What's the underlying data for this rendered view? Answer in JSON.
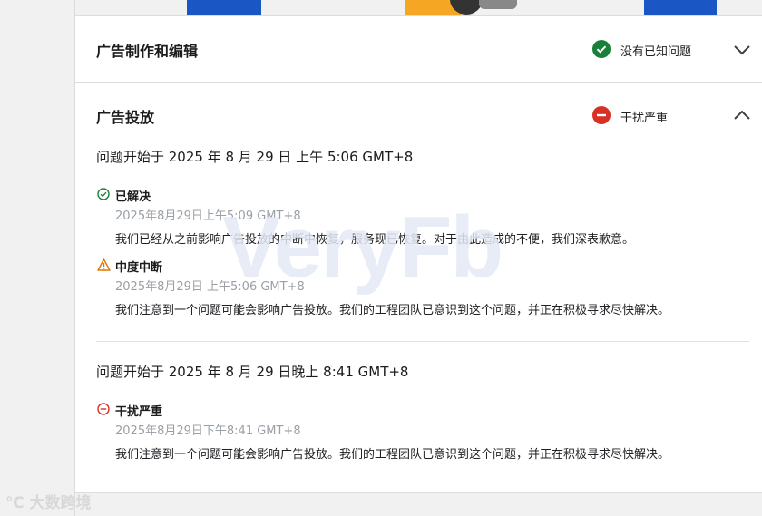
{
  "sections": [
    {
      "title": "广告制作和编辑",
      "status": "没有已知问题",
      "status_color": "#188038"
    },
    {
      "title": "广告投放",
      "status": "干扰严重",
      "status_color": "#d93025"
    }
  ],
  "incidents": [
    {
      "started": "问题开始于 2025 年 8 月 29 日 上午 5:06 GMT+8",
      "events": [
        {
          "icon": "check-circle-icon",
          "title": "已解决",
          "time": "2025年8月29日上午5:09 GMT+8",
          "desc": "我们已经从之前影响广告投放的中断中恢复，服务现已恢复。对于由此造成的不便，我们深表歉意。"
        },
        {
          "icon": "warning-icon",
          "title": "中度中断",
          "time": "2025年8月29日 上午5:06 GMT+8",
          "desc": "我们注意到一个问题可能会影响广告投放。我们的工程团队已意识到这个问题，并正在积极寻求尽快解决。"
        }
      ]
    },
    {
      "started": "问题开始于 2025 年 8 月 29 日晚上 8:41 GMT+8",
      "events": [
        {
          "icon": "minus-circle-icon",
          "title": "干扰严重",
          "time": "2025年8月29日下午8:41 GMT+8",
          "desc": "我们注意到一个问题可能会影响广告投放。我们的工程团队已意识到这个问题，并正在积极寻求尽快解决。"
        }
      ]
    }
  ],
  "watermark": "VeryFb",
  "logo_text": "大数跨境"
}
